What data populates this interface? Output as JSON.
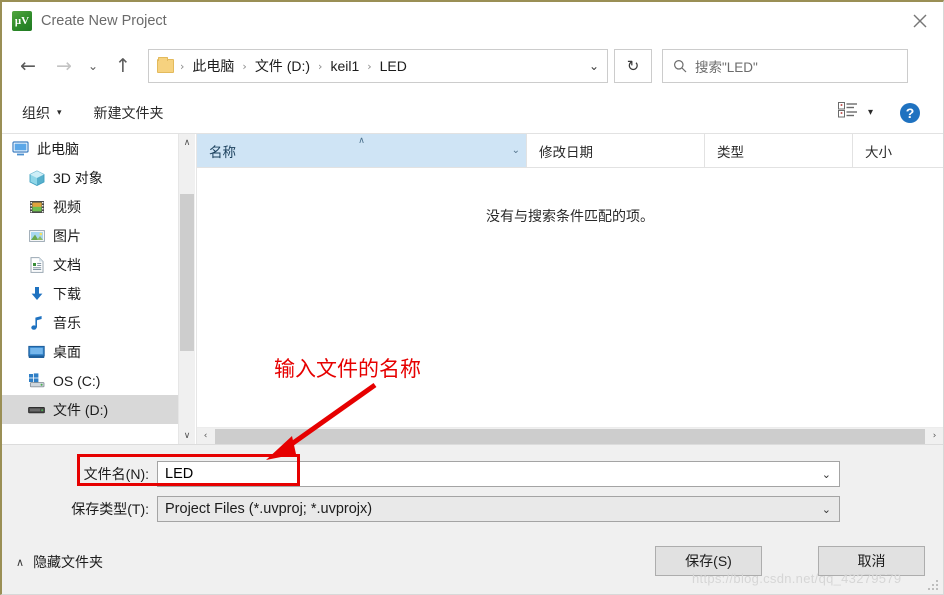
{
  "window": {
    "title": "Create New Project",
    "app_icon": "keil-uvision-icon",
    "close_label": "✕",
    "border_color": "#9a8f55"
  },
  "nav": {
    "back_icon": "←",
    "forward_icon": "→",
    "recent_icon": "⌄",
    "up_icon": "↑",
    "refresh_icon": "↻",
    "address_chevron": "⌄",
    "breadcrumbs": [
      "此电脑",
      "文件 (D:)",
      "keil1",
      "LED"
    ],
    "separator": "›"
  },
  "search": {
    "placeholder": "搜索\"LED\"",
    "icon": "search-icon"
  },
  "command_bar": {
    "organize_label": "组织",
    "organize_caret": "▾",
    "new_folder_label": "新建文件夹",
    "view_caret": "▾",
    "help_label": "?"
  },
  "sidebar": {
    "items": [
      {
        "label": "此电脑",
        "icon": "computer-icon",
        "selected": false,
        "indent": false
      },
      {
        "label": "3D 对象",
        "icon": "3d-objects-icon",
        "selected": false,
        "indent": true
      },
      {
        "label": "视频",
        "icon": "videos-icon",
        "selected": false,
        "indent": true
      },
      {
        "label": "图片",
        "icon": "pictures-icon",
        "selected": false,
        "indent": true
      },
      {
        "label": "文档",
        "icon": "documents-icon",
        "selected": false,
        "indent": true
      },
      {
        "label": "下载",
        "icon": "downloads-icon",
        "selected": false,
        "indent": true
      },
      {
        "label": "音乐",
        "icon": "music-icon",
        "selected": false,
        "indent": true
      },
      {
        "label": "桌面",
        "icon": "desktop-icon",
        "selected": false,
        "indent": true
      },
      {
        "label": "OS (C:)",
        "icon": "os-drive-icon",
        "selected": false,
        "indent": true
      },
      {
        "label": "文件 (D:)",
        "icon": "drive-icon",
        "selected": true,
        "indent": true
      }
    ],
    "scroll_up": "∧",
    "scroll_down": "∨"
  },
  "file_list": {
    "columns": [
      {
        "label": "名称",
        "sorted": true,
        "sort_mark": "∧",
        "drop": "⌄"
      },
      {
        "label": "修改日期",
        "sorted": false
      },
      {
        "label": "类型",
        "sorted": false
      },
      {
        "label": "大小",
        "sorted": false
      }
    ],
    "rows": [],
    "empty_message": "没有与搜索条件匹配的项。",
    "hscroll_left": "‹",
    "hscroll_right": "›"
  },
  "form": {
    "filename_label": "文件名(N):",
    "filename_value": "LED",
    "filename_placeholder": "",
    "filetype_label": "保存类型(T):",
    "filetype_value": "Project Files (*.uvproj; *.uvprojx)",
    "combo_caret": "⌄"
  },
  "footer": {
    "hide_folders_label": "隐藏文件夹",
    "hide_folders_chevron": "∧",
    "save_label": "保存(S)",
    "cancel_label": "取消"
  },
  "annotations": {
    "text": "输入文件的名称",
    "color": "#e60000"
  },
  "watermark": "https://blog.csdn.net/qq_43279579"
}
